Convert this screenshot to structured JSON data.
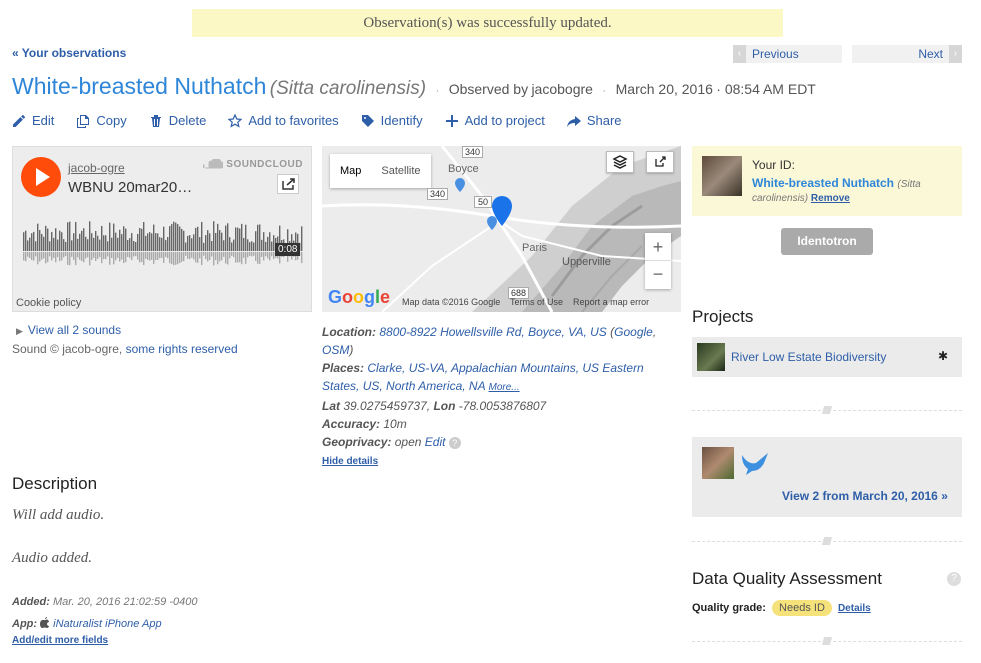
{
  "flash": "Observation(s) was successfully updated.",
  "nav": {
    "back": "« Your observations",
    "previous": "Previous",
    "next": "Next",
    "prev_arrow": "‹",
    "next_arrow": "›"
  },
  "observation": {
    "common_name": "White-breasted Nuthatch",
    "scientific_name": "(Sitta carolinensis)",
    "observed_by_label": "Observed by",
    "observer": "jacobogre",
    "date": "March 20, 2016",
    "time": "· 08:54 AM EDT",
    "dot": "·"
  },
  "actions": [
    {
      "label": "Edit",
      "icon": "pencil-icon"
    },
    {
      "label": "Copy",
      "icon": "copy-icon"
    },
    {
      "label": "Delete",
      "icon": "trash-icon"
    },
    {
      "label": "Add to favorites",
      "icon": "star-icon"
    },
    {
      "label": "Identify",
      "icon": "tag-icon"
    },
    {
      "label": "Add to project",
      "icon": "plus-icon"
    },
    {
      "label": "Share",
      "icon": "share-icon"
    }
  ],
  "sound": {
    "user": "jacob-ogre",
    "track": "WBNU 20mar20…",
    "brand": "SOUNDCLOUD",
    "duration": "0:08",
    "cookie": "Cookie policy",
    "view_all": "View all 2 sounds",
    "license_prefix": "Sound © jacob-ogre,",
    "license_link": "some rights reserved"
  },
  "map": {
    "type_map": "Map",
    "type_satellite": "Satellite",
    "labels": {
      "boyce": "Boyce",
      "paris": "Paris",
      "upperville": "Upperville",
      "r340": "340",
      "r50": "50",
      "r688": "688",
      "r340b": "340"
    },
    "google": "Google",
    "footer": "Map data ©2016 Google    Terms of Use    Report a map error",
    "zoom_in": "+",
    "zoom_out": "−"
  },
  "location": {
    "location_label": "Location:",
    "location_value": "8800-8922 Howellsville Rd, Boyce, VA, US",
    "google_link": "Google",
    "osm_link": "OSM",
    "places_label": "Places:",
    "places": "Clarke, US-VA, Appalachian Mountains, US Eastern States, US, North America, NA",
    "more": "More...",
    "lat_label": "Lat",
    "lat": "39.0275459737,",
    "lon_label": "Lon",
    "lon": "-78.0053876807",
    "accuracy_label": "Accuracy:",
    "accuracy": "10m",
    "geoprivacy_label": "Geoprivacy:",
    "geoprivacy": "open",
    "geoprivacy_edit": "Edit",
    "hide_details": "Hide details"
  },
  "your_id": {
    "label": "Your ID:",
    "name": "White-breasted Nuthatch",
    "sci": "(Sitta carolinensis)",
    "remove": "Remove",
    "identotron": "Identotron"
  },
  "projects": {
    "heading": "Projects",
    "items": [
      {
        "name": "River Low Estate Biodiversity"
      }
    ]
  },
  "similar": {
    "view": "View 2 from March 20, 2016 »"
  },
  "dqa": {
    "heading": "Data Quality Assessment",
    "grade_label": "Quality grade:",
    "grade": "Needs ID",
    "details": "Details"
  },
  "description": {
    "heading": "Description",
    "paragraphs": [
      "Will add audio.",
      "Audio added."
    ],
    "added_label": "Added:",
    "added": "Mar. 20, 2016 21:02:59 -0400",
    "app_label": "App:",
    "app": "iNaturalist iPhone App",
    "add_edit": "Add/edit more fields"
  },
  "colors": {
    "accent": "#2e86d8",
    "link": "#2e5ea8",
    "flash_bg": "#fbf8c5",
    "soundcloud": "#ff4c0a",
    "badge": "#f6e27a"
  }
}
